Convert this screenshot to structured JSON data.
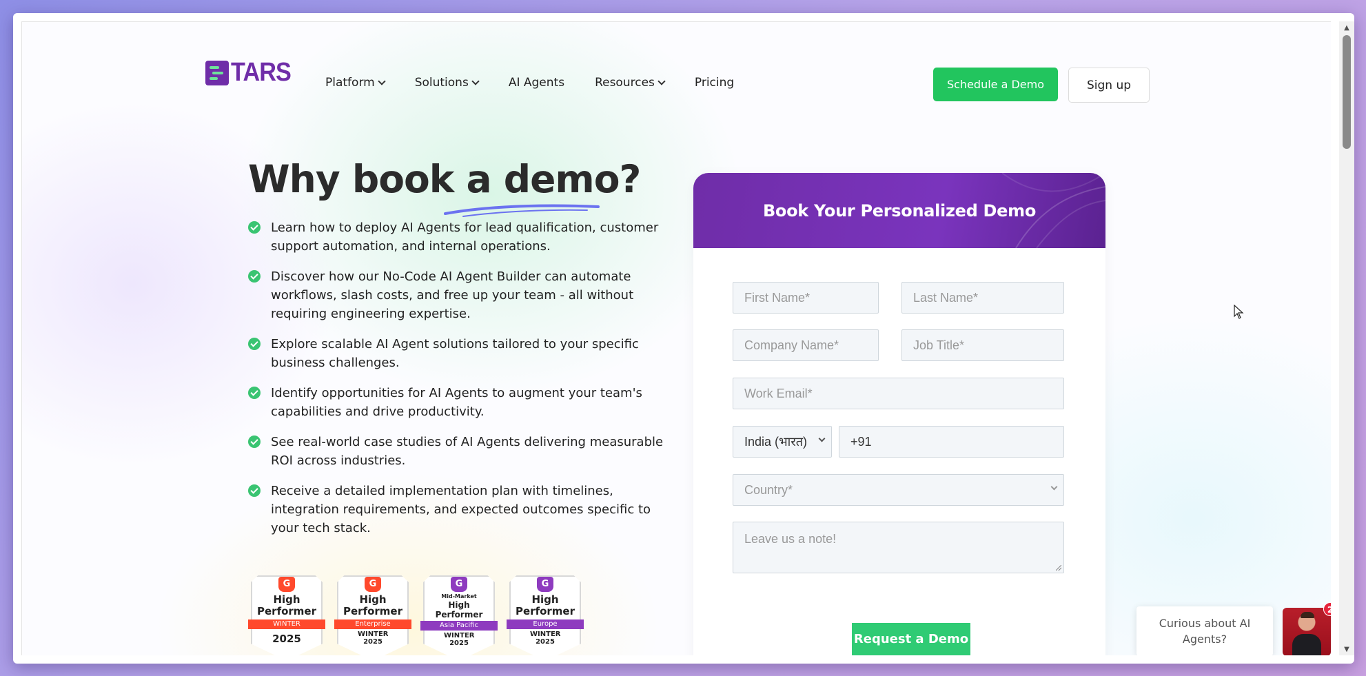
{
  "brand": {
    "name": "TARS",
    "color": "#6f2da8",
    "accent": "#22c55e"
  },
  "nav": {
    "items": [
      {
        "label": "Platform",
        "dropdown": true
      },
      {
        "label": "Solutions",
        "dropdown": true
      },
      {
        "label": "AI Agents",
        "dropdown": false
      },
      {
        "label": "Resources",
        "dropdown": true
      },
      {
        "label": "Pricing",
        "dropdown": false
      }
    ],
    "schedule_label": "Schedule a Demo",
    "signup_label": "Sign up"
  },
  "hero": {
    "title": "Why book a demo?",
    "benefits": [
      "Learn how to deploy AI Agents for lead qualification, customer support automation, and internal operations.",
      "Discover how our No-Code AI Agent Builder can automate workflows, slash costs, and free up your team - all without requiring engineering expertise.",
      "Explore scalable AI Agent solutions tailored to your specific business challenges.",
      "Identify opportunities for AI Agents to augment your team's capabilities and drive productivity.",
      "See real-world case studies of AI Agents delivering measurable ROI across industries.",
      "Receive a detailed implementation plan with timelines, integration requirements, and expected outcomes specific to your tech stack."
    ]
  },
  "badges": [
    {
      "g2": "G",
      "sub": "",
      "title": "High Performer",
      "ribbon": "WINTER",
      "season": "2025",
      "g2_color": "#ff492c",
      "ribbon_color": "#ff492c"
    },
    {
      "g2": "G",
      "sub": "",
      "title": "High Performer",
      "ribbon": "Enterprise",
      "season": "WINTER 2025",
      "g2_color": "#ff492c",
      "ribbon_color": "#ff492c"
    },
    {
      "g2": "G",
      "sub": "Mid-Market",
      "title": "High Performer",
      "ribbon": "Asia Pacific",
      "season": "WINTER 2025",
      "g2_color": "#8e3bbf",
      "ribbon_color": "#8e3bbf"
    },
    {
      "g2": "G",
      "sub": "",
      "title": "High Performer",
      "ribbon": "Europe",
      "season": "WINTER 2025",
      "g2_color": "#8e3bbf",
      "ribbon_color": "#8e3bbf"
    }
  ],
  "form": {
    "title": "Book Your Personalized Demo",
    "first_name_placeholder": "First Name*",
    "last_name_placeholder": "Last Name*",
    "company_placeholder": "Company Name*",
    "job_title_placeholder": "Job Title*",
    "email_placeholder": "Work Email*",
    "phone_country": "India (भारत)",
    "phone_value": "+91",
    "country_placeholder": "Country*",
    "note_placeholder": "Leave us a note!",
    "submit_label": "Request a Demo"
  },
  "chat": {
    "prompt": "Curious about AI Agents?",
    "unread_count": "2"
  }
}
